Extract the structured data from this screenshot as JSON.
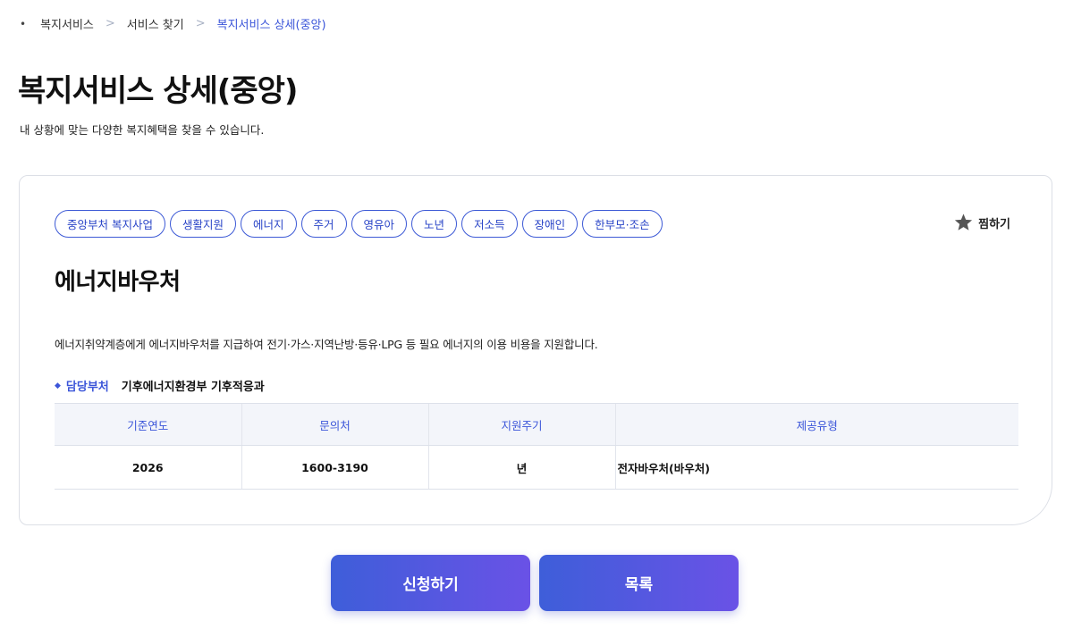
{
  "breadcrumb": {
    "items": [
      "복지서비스",
      "서비스 찾기",
      "복지서비스 상세(중앙)"
    ]
  },
  "page": {
    "title": "복지서비스 상세(중앙)",
    "subtitle": "내 상황에 맞는 다양한 복지혜택을 찾을 수 있습니다."
  },
  "service": {
    "tags": [
      "중앙부처 복지사업",
      "생활지원",
      "에너지",
      "주거",
      "영유아",
      "노년",
      "저소득",
      "장애인",
      "한부모·조손"
    ],
    "favorite_label": "찜하기",
    "title": "에너지바우처",
    "description": "에너지취약계층에게 에너지바우처를 지급하여 전기·가스·지역난방·등유·LPG 등 필요 에너지의 이용 비용을 지원합니다.",
    "department_label": "담당부처",
    "department_value": "기후에너지환경부 기후적응과"
  },
  "table": {
    "headers": [
      "기준연도",
      "문의처",
      "지원주기",
      "제공유형"
    ],
    "row": [
      "2026",
      "1600-3190",
      "년",
      "전자바우처(바우처)"
    ]
  },
  "buttons": {
    "apply_label": "신청하기",
    "list_label": "목록"
  },
  "colors": {
    "accent": "#3b55d9",
    "button_gradient_start": "#3e5ed9",
    "button_gradient_end": "#6a52e6",
    "star": "#555555"
  },
  "icons": {
    "favorite": "star-icon"
  }
}
